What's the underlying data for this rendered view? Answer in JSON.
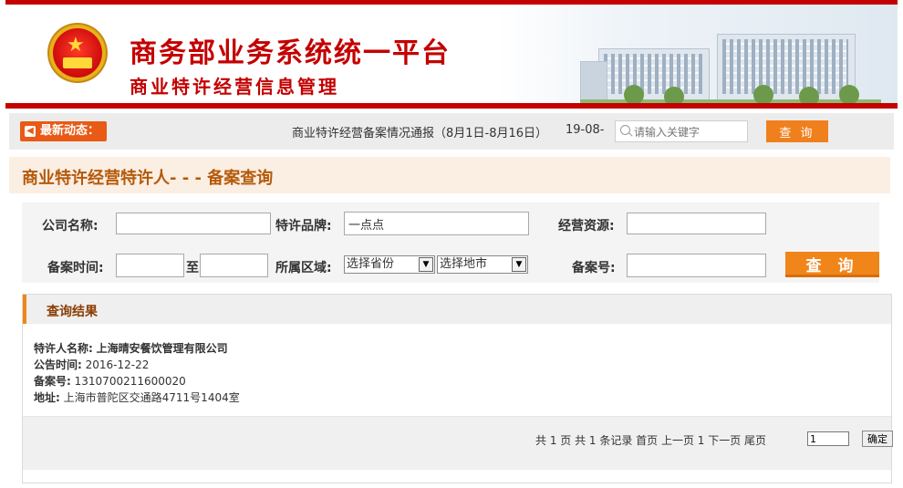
{
  "header": {
    "title": "商务部业务系统统一平台",
    "subtitle": "商业特许经营信息管理"
  },
  "news": {
    "label": "最新动态：",
    "headline": "商业特许经营备案情况通报（8月1日-8月16日）",
    "date": "19-08-",
    "search_placeholder": "请输入关键字",
    "search_button": "查 询"
  },
  "page_title": "商业特许经营特许人- - - 备案查询",
  "form": {
    "company_label": "公司名称:",
    "company_value": "",
    "brand_label": "特许品牌:",
    "brand_value": "一点点",
    "resource_label": "经营资源:",
    "resource_value": "",
    "time_label": "备案时间:",
    "time_from": "",
    "time_to_label": "至",
    "time_to": "",
    "region_label": "所属区域:",
    "province_selected": "选择省份",
    "city_selected": "选择地市",
    "record_label": "备案号:",
    "record_value": "",
    "search_button": "查 询"
  },
  "results": {
    "title": "查询结果",
    "items": [
      {
        "franchisor_key": "特许人名称:",
        "franchisor": "上海晴安餐饮管理有限公司",
        "date_key": "公告时间:",
        "date": "2016-12-22",
        "record_key": "备案号:",
        "record": "1310700211600020",
        "address_key": "地址:",
        "address": "上海市普陀区交通路4711号1404室"
      }
    ],
    "pager": {
      "text": "共 1 页 共 1 条记录 首页 上一页 1 下一页 尾页",
      "page_input": "1",
      "confirm": "确定"
    }
  },
  "colors": {
    "brand_red": "#c40000",
    "accent_orange": "#f08519",
    "title_brown": "#b45a0a"
  }
}
